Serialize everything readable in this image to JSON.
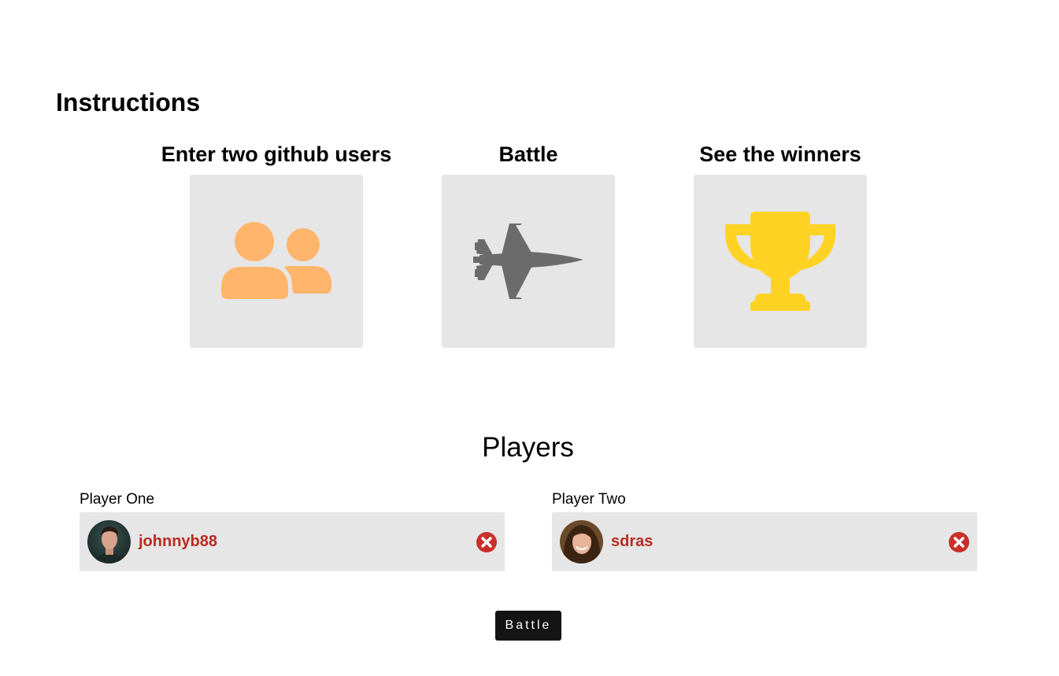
{
  "instructions": {
    "title": "Instructions",
    "steps": [
      {
        "title": "Enter two github users",
        "icon": "users-icon",
        "color": "#ffb56b"
      },
      {
        "title": "Battle",
        "icon": "fighter-jet-icon",
        "color": "#6b6b6b"
      },
      {
        "title": "See the winners",
        "icon": "trophy-icon",
        "color": "#ffd324"
      }
    ]
  },
  "players": {
    "title": "Players",
    "one": {
      "label": "Player One",
      "username": "johnnyb88"
    },
    "two": {
      "label": "Player Two",
      "username": "sdras"
    }
  },
  "battle_button": "Battle",
  "colors": {
    "username": "#b92b1f",
    "remove_icon": "#c8312a",
    "card_bg": "#e6e6e6",
    "button_bg": "#141414"
  }
}
